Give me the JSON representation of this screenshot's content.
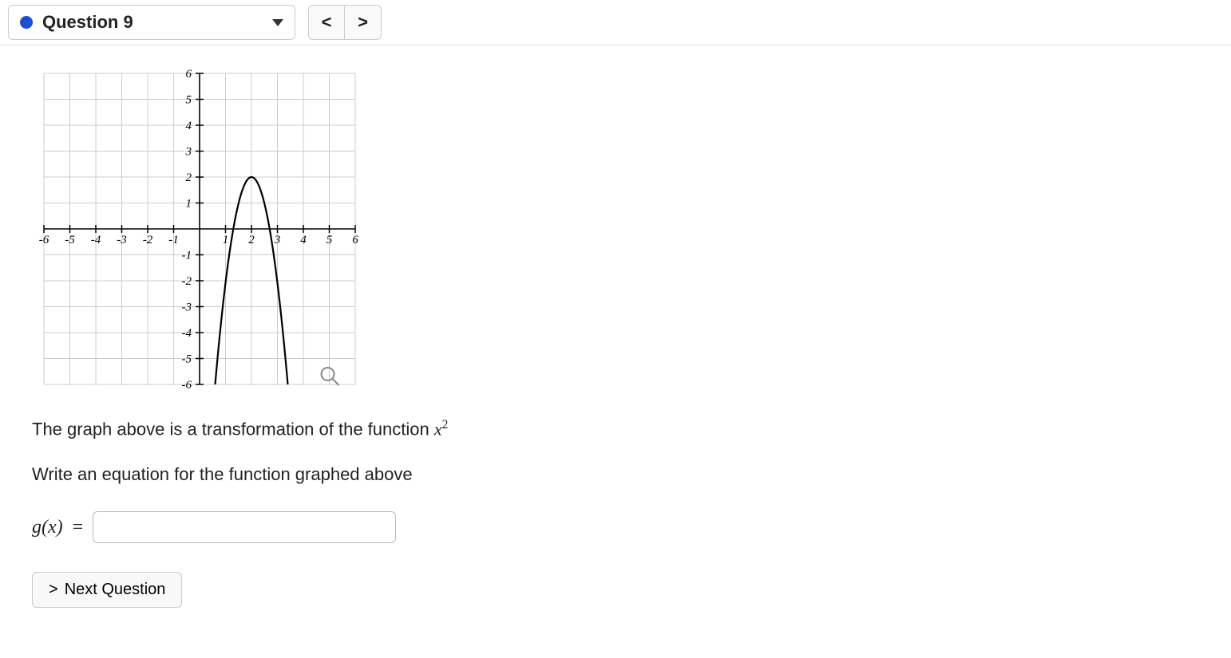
{
  "toolbar": {
    "question_label": "Question 9",
    "prev_label": "<",
    "next_nav_label": ">"
  },
  "question": {
    "desc_line1_prefix": "The graph above is a transformation of the function ",
    "desc_line1_var": "x",
    "desc_line2": "Write an equation for the function graphed above",
    "gx_label": "g(x)",
    "eq_sign": "=",
    "answer_value": ""
  },
  "next_button": {
    "label": "Next Question"
  },
  "chart_data": {
    "type": "line",
    "title": "",
    "description": "Downward-opening parabola, vertex at approximately (2, 2), passing through roughly (0.6, -6) and (4.4, -6).",
    "xlim": [
      -6,
      6
    ],
    "ylim": [
      -6,
      6
    ],
    "x_ticks": [
      -6,
      -5,
      -4,
      -3,
      -2,
      -1,
      1,
      2,
      3,
      4,
      5,
      6
    ],
    "y_ticks": [
      -6,
      -5,
      -4,
      -3,
      -2,
      -1,
      1,
      2,
      3,
      4,
      5,
      6
    ],
    "series": [
      {
        "name": "g(x)",
        "vertex": [
          2,
          2
        ],
        "points": [
          [
            0.6,
            -6
          ],
          [
            0.75,
            -4.7
          ],
          [
            1,
            -2
          ],
          [
            1.5,
            1
          ],
          [
            2,
            2
          ],
          [
            2.5,
            1
          ],
          [
            3,
            -2
          ],
          [
            3.25,
            -4.7
          ],
          [
            3.4,
            -6
          ]
        ],
        "approx_formula": "2 - 4*(x-2)^2"
      }
    ]
  }
}
